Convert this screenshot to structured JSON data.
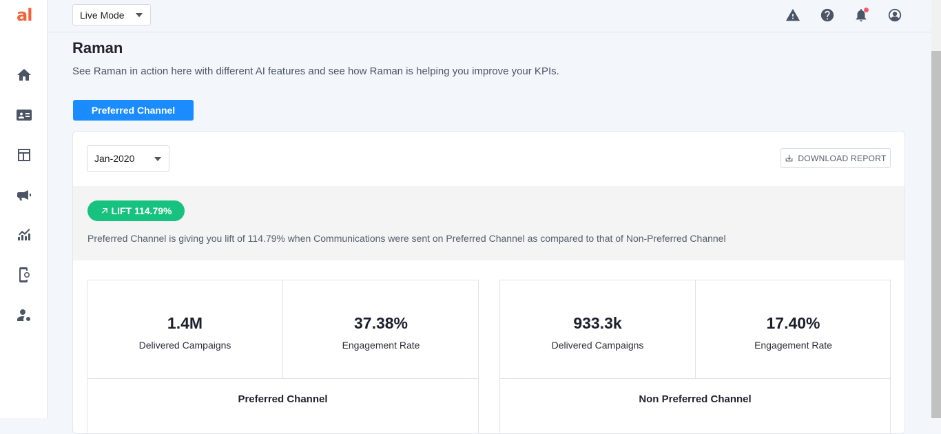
{
  "app": {
    "logo_text": "al",
    "brand_color": "#f0633a",
    "accent_color": "#1a8cff",
    "success_color": "#17c27f"
  },
  "topbar": {
    "mode_select_value": "Live Mode",
    "icons": [
      "warning-icon",
      "help-icon",
      "bell-icon",
      "user-account-icon"
    ]
  },
  "sidebar": {
    "items": [
      {
        "icon": "home-icon"
      },
      {
        "icon": "contact-card-icon"
      },
      {
        "icon": "layout-icon"
      },
      {
        "icon": "megaphone-icon"
      },
      {
        "icon": "analytics-icon"
      },
      {
        "icon": "mobile-web-icon"
      },
      {
        "icon": "user-settings-icon"
      }
    ]
  },
  "page": {
    "title": "Raman",
    "subtitle": "See Raman in action here with different AI features and see how Raman is helping you improve your KPIs.",
    "tab_label": "Preferred Channel"
  },
  "report": {
    "month_value": "Jan-2020",
    "download_label": "DOWNLOAD REPORT",
    "lift_label": "LIFT 114.79%",
    "lift_description": "Preferred Channel is giving you lift of 114.79% when Communications were sent on Preferred Channel as compared to that of Non-Preferred Channel"
  },
  "channels": [
    {
      "name": "Preferred Channel",
      "delivered_value": "1.4M",
      "delivered_label": "Delivered Campaigns",
      "engagement_value": "37.38%",
      "engagement_label": "Engagement Rate"
    },
    {
      "name": "Non Preferred Channel",
      "delivered_value": "933.3k",
      "delivered_label": "Delivered Campaigns",
      "engagement_value": "17.40%",
      "engagement_label": "Engagement Rate"
    }
  ]
}
